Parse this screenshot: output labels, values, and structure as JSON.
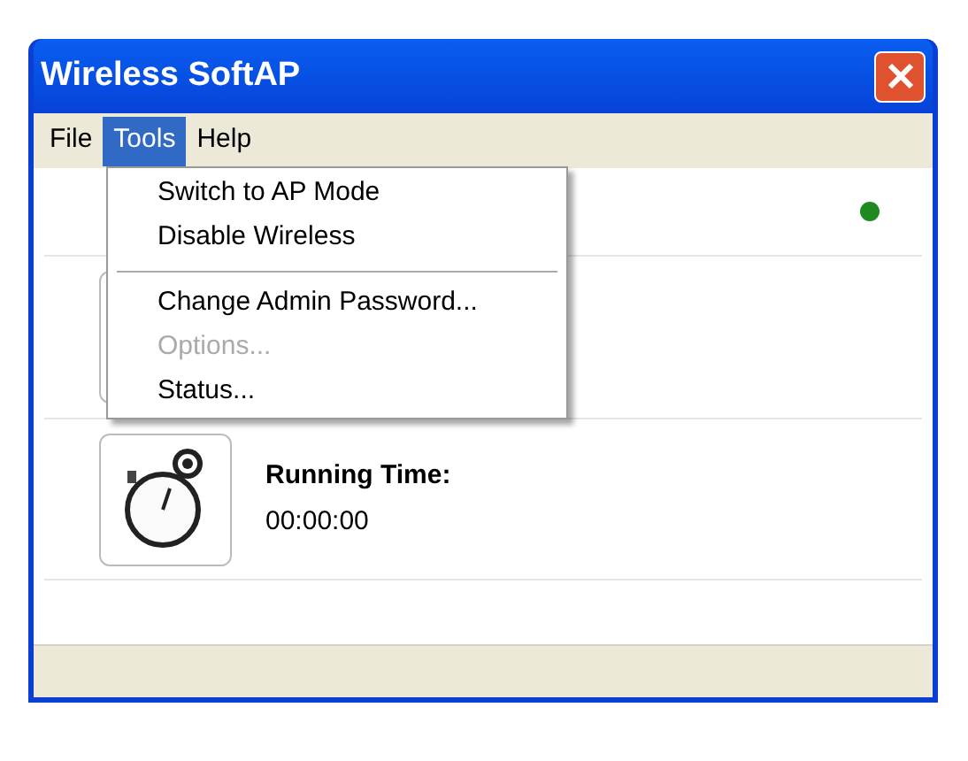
{
  "window": {
    "title": "Wireless SoftAP"
  },
  "menu_bar": [
    {
      "label": "File",
      "selected": false
    },
    {
      "label": "Tools",
      "selected": true
    },
    {
      "label": "Help",
      "selected": false
    }
  ],
  "tools_menu": [
    {
      "kind": "item",
      "label": "Switch to AP Mode",
      "disabled": false
    },
    {
      "kind": "item",
      "label": "Disable Wireless",
      "disabled": false
    },
    {
      "kind": "separator"
    },
    {
      "kind": "item",
      "label": "Change Admin Password...",
      "disabled": false
    },
    {
      "kind": "item",
      "label": "Options...",
      "disabled": true
    },
    {
      "kind": "item",
      "label": "Status...",
      "disabled": false
    }
  ],
  "status_indicator": {
    "color": "#1f8a1f"
  },
  "running_time": {
    "label": "Running Time:",
    "value": "00:00:00"
  }
}
